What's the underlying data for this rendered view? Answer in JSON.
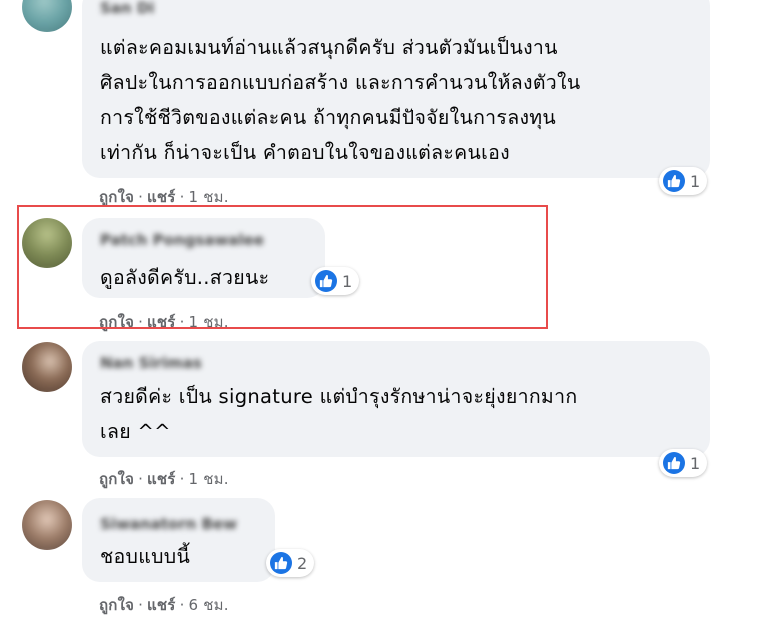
{
  "colors": {
    "bubble": "#f0f2f5",
    "like_blue": "#1b74e4",
    "highlight_red": "#e84b4b",
    "secondary_text": "#65676b"
  },
  "comments": [
    {
      "author": "San Di",
      "text": "แต่ละคอมเมนท์อ่านแล้วสนุกดีครับ ส่วนตัวมันเป็นงาน\nศิลปะในการออกแบบก่อสร้าง และการคำนวนให้ลงตัวใน\nการใช้ชีวิตของแต่ละคน ถ้าทุกคนมีปัจจัยในการลงทุน\nเท่ากัน ก็น่าจะเป็น คำตอบในใจของแต่ละคนเอง",
      "like_label": "ถูกใจ",
      "share_label": "แชร์",
      "time": "1 ชม.",
      "reaction_icon": "like-thumb-icon",
      "reaction_count": "1"
    },
    {
      "author": "Patch Pongsawalee",
      "text": "ดูอลังดีครับ..สวยนะ",
      "like_label": "ถูกใจ",
      "share_label": "แชร์",
      "time": "1 ชม.",
      "reaction_icon": "like-thumb-icon",
      "reaction_count": "1",
      "highlighted": true
    },
    {
      "author": "Nan Sirimas",
      "text": "สวยดีค่ะ เป็น signature แต่บำรุงรักษาน่าจะยุ่งยากมาก\nเลย ^^",
      "like_label": "ถูกใจ",
      "share_label": "แชร์",
      "time": "1 ชม.",
      "reaction_icon": "like-thumb-icon",
      "reaction_count": "1"
    },
    {
      "author": "Siwanatorn Bew",
      "text": "ชอบแบบนี้",
      "like_label": "ถูกใจ",
      "share_label": "แชร์",
      "time": "6 ชม.",
      "reaction_icon": "like-thumb-icon",
      "reaction_count": "2"
    }
  ]
}
